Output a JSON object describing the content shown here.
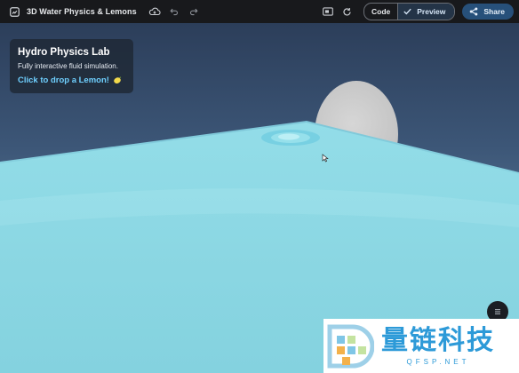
{
  "toolbar": {
    "title": "3D Water Physics & Lemons",
    "code_label": "Code",
    "preview_label": "Preview",
    "share_label": "Share",
    "icons": [
      "app-icon",
      "cloud-sync-icon",
      "undo-icon",
      "redo-icon",
      "screen-icon",
      "refresh-icon",
      "check-icon",
      "share-icon"
    ]
  },
  "panel": {
    "title": "Hydro Physics Lab",
    "subtitle": "Fully interactive fluid simulation.",
    "action": "Click to drop a Lemon!",
    "action_icon": "lemon-icon"
  },
  "watermark": {
    "cn_text": "量链科技",
    "en_text": "QFSP.NET"
  },
  "colors": {
    "toolbar_bg": "#18191c",
    "accent_link": "#6fd0ff",
    "share_bg": "#27507a",
    "water": "#8fdbe6",
    "watermark_blue": "#2d9ad8"
  }
}
